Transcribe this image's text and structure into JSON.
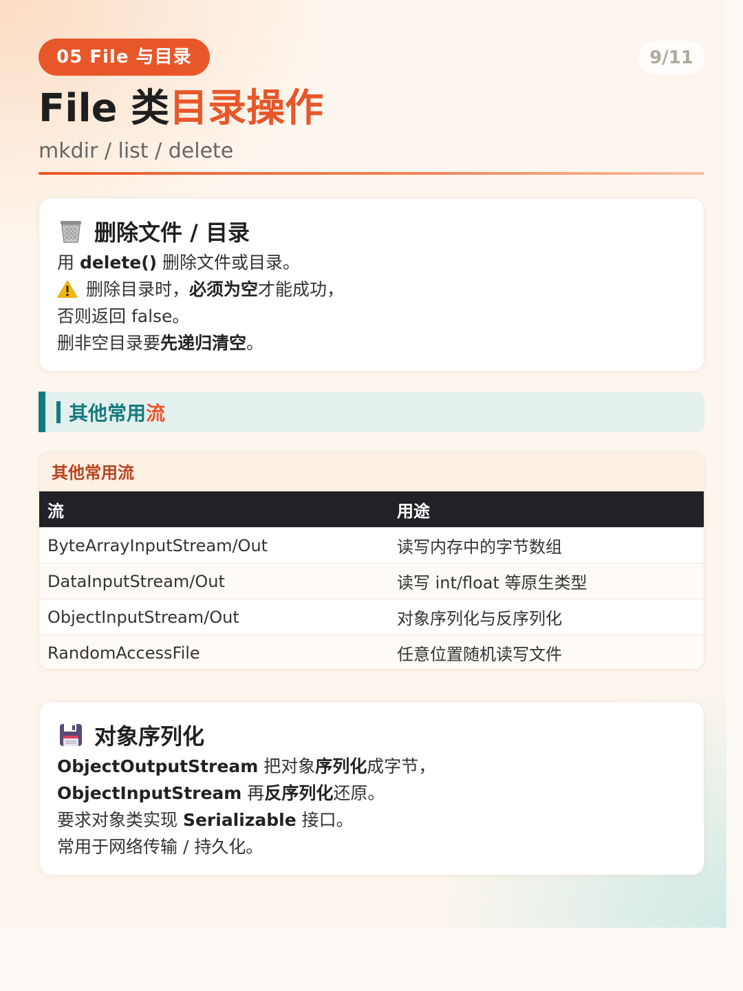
{
  "header": {
    "chapter_badge": "05 File 与目录",
    "page_indicator": "9/11",
    "title_plain": "File 类",
    "title_accent": "目录操作",
    "subtitle": "mkdir / list / delete"
  },
  "colors": {
    "accent": "#e8572a",
    "teal": "#137b7e",
    "dark": "#202227"
  },
  "card_delete": {
    "icon": "wastebasket-icon",
    "heading": "删除文件 / 目录",
    "line1": {
      "pre": "用 ",
      "bold": "delete()",
      "post": " 删除文件或目录。"
    },
    "line2": {
      "icon": "warning-icon",
      "pre": "删除目录时，",
      "bold": "必须为空",
      "post": "才能成功，"
    },
    "line3": "否则返回 false。",
    "line4": {
      "pre": "删非空目录要",
      "bold": "先递归清空",
      "post": "。"
    }
  },
  "section": {
    "title_plain": "其他常用",
    "title_accent": "流"
  },
  "streams_table": {
    "caption": "其他常用流",
    "columns": [
      "流",
      "用途"
    ],
    "rows": [
      [
        "ByteArrayInputStream/Out",
        "读写内存中的字节数组"
      ],
      [
        "DataInputStream/Out",
        "读写 int/float 等原生类型"
      ],
      [
        "ObjectInputStream/Out",
        "对象序列化与反序列化"
      ],
      [
        "RandomAccessFile",
        "任意位置随机读写文件"
      ]
    ]
  },
  "card_serial": {
    "icon": "floppy-disk-icon",
    "heading": "对象序列化",
    "line1": {
      "bold1": "ObjectOutputStream",
      "mid": " 把对象",
      "bold2": "序列化",
      "post": "成字节，"
    },
    "line2": {
      "bold1": "ObjectInputStream",
      "mid": " 再",
      "bold2": "反序列化",
      "post": "还原。"
    },
    "line3": {
      "pre": "要求对象类实现 ",
      "bold": "Serializable",
      "post": " 接口。"
    },
    "line4": "常用于网络传输 / 持久化。"
  }
}
